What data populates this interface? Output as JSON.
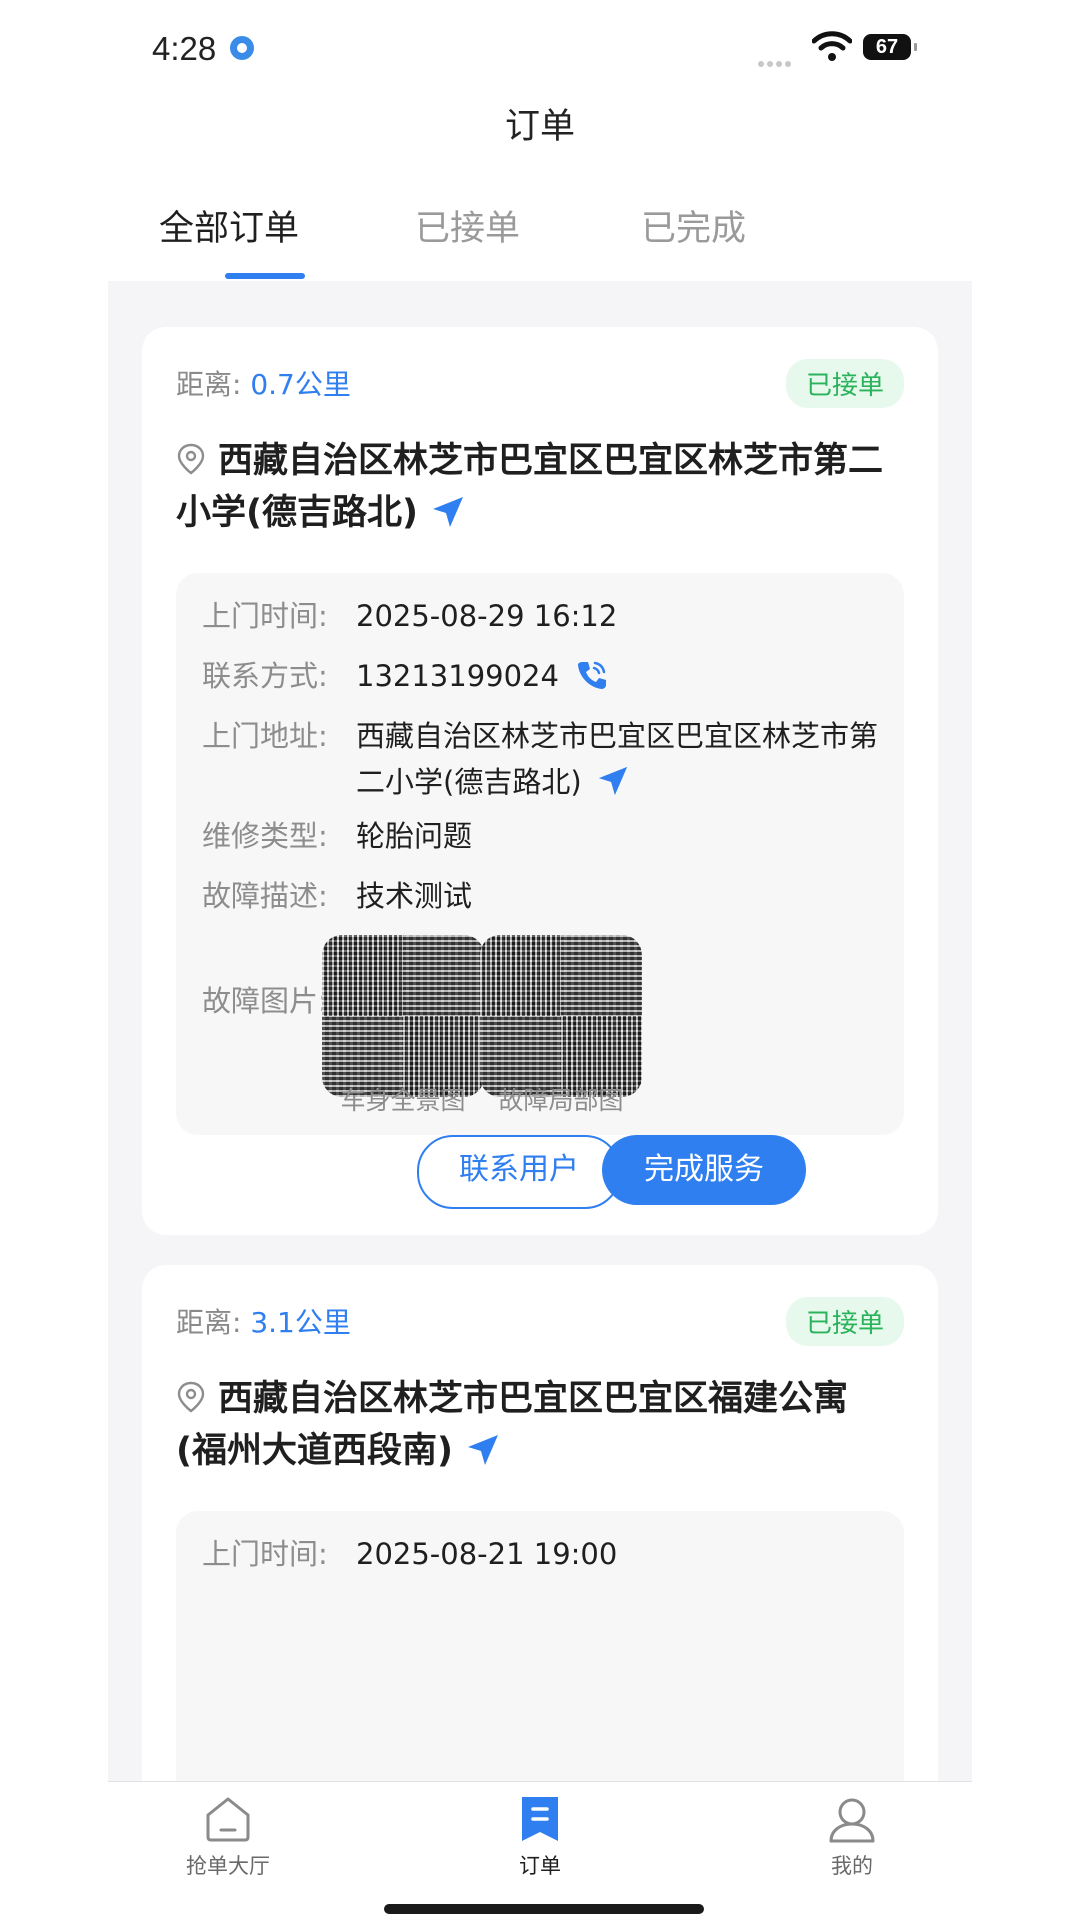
{
  "status_bar": {
    "time": "4:28",
    "battery": "67"
  },
  "page": {
    "title": "订单"
  },
  "tabs": [
    {
      "label": "全部订单",
      "active": true
    },
    {
      "label": "已接单",
      "active": false
    },
    {
      "label": "已完成",
      "active": false
    }
  ],
  "orders": [
    {
      "distance_label": "距离:",
      "distance_value": "0.7公里",
      "status": "已接单",
      "title_address": "西藏自治区林芝市巴宜区巴宜区林芝市第二小学(德吉路北)",
      "visit_time_label": "上门时间:",
      "visit_time": "2025-08-29 16:12",
      "contact_label": "联系方式:",
      "contact": "13213199024",
      "address_label": "上门地址:",
      "address": "西藏自治区林芝市巴宜区巴宜区林芝市第二小学(德吉路北)",
      "repair_type_label": "维修类型:",
      "repair_type": "轮胎问题",
      "fault_desc_label": "故障描述:",
      "fault_desc": "技术测试",
      "fault_images_label": "故障图片:",
      "images": [
        {
          "caption": "车身全景图"
        },
        {
          "caption": "故障局部图"
        }
      ],
      "buttons": {
        "contact_user": "联系用户",
        "complete_service": "完成服务"
      }
    },
    {
      "distance_label": "距离:",
      "distance_value": "3.1公里",
      "status": "已接单",
      "title_address": "西藏自治区林芝市巴宜区巴宜区福建公寓(福州大道西段南)",
      "visit_time_label": "上门时间:",
      "visit_time": "2025-08-21 19:00"
    }
  ],
  "bottom_nav": [
    {
      "label": "抢单大厅",
      "icon": "home-icon",
      "active": false
    },
    {
      "label": "订单",
      "icon": "order-bookmark-icon",
      "active": true
    },
    {
      "label": "我的",
      "icon": "user-icon",
      "active": false
    }
  ],
  "colors": {
    "accent": "#2f7ff0",
    "status_green": "#2ab35a",
    "status_green_bg": "#e7f8ec",
    "list_bg": "#f5f5f7"
  }
}
